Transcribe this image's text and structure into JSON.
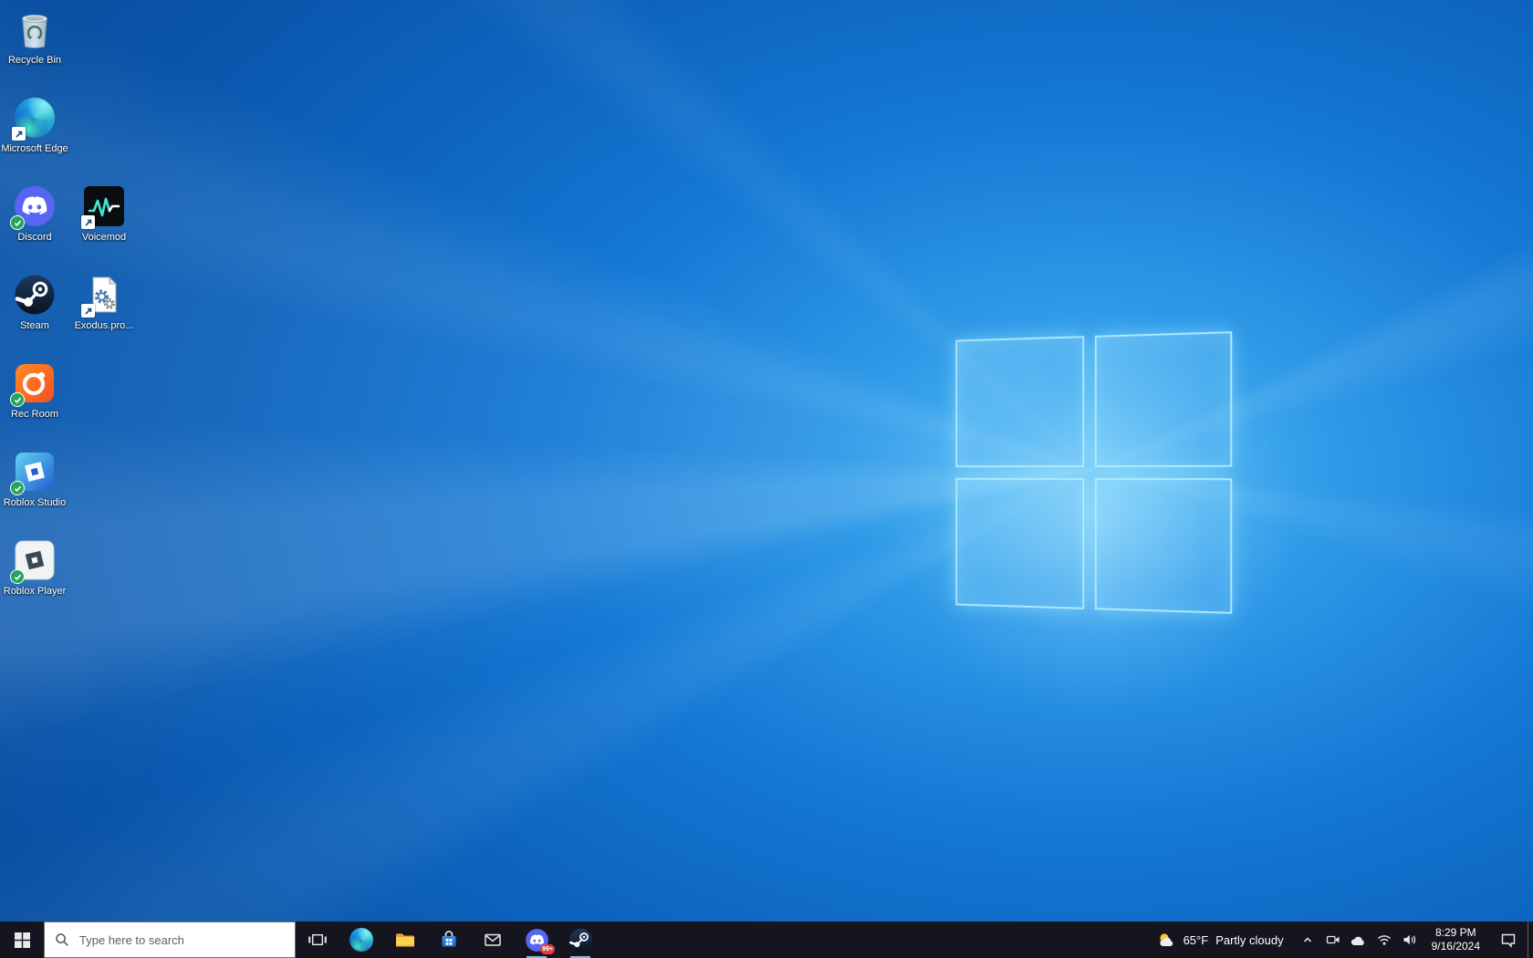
{
  "desktop": {
    "icons": [
      {
        "name": "recycle-bin",
        "label": "Recycle Bin",
        "overlay": "none"
      },
      {
        "name": "microsoft-edge",
        "label": "Microsoft Edge",
        "overlay": "shortcut-arrow"
      },
      {
        "name": "discord",
        "label": "Discord",
        "overlay": "sync-check"
      },
      {
        "name": "voicemod",
        "label": "Voicemod",
        "overlay": "shortcut-arrow"
      },
      {
        "name": "steam",
        "label": "Steam",
        "overlay": "none"
      },
      {
        "name": "exodus",
        "label": "Exodus.pro...",
        "overlay": "shortcut-arrow"
      },
      {
        "name": "rec-room",
        "label": "Rec Room",
        "overlay": "sync-check"
      },
      {
        "name": "roblox-studio",
        "label": "Roblox Studio",
        "overlay": "sync-check"
      },
      {
        "name": "roblox-player",
        "label": "Roblox Player",
        "overlay": "sync-check"
      }
    ]
  },
  "taskbar": {
    "search": {
      "placeholder": "Type here to search"
    },
    "app_icons": [
      "start",
      "task-view",
      "edge",
      "file-explorer",
      "microsoft-store",
      "mail",
      "discord",
      "steam"
    ],
    "discord_badge": "99+",
    "running_apps": [
      "discord",
      "steam"
    ]
  },
  "tray": {
    "weather": {
      "temperature": "65°F",
      "condition": "Partly cloudy"
    },
    "icons": [
      "hidden-icons-chevron",
      "meet-now-camera",
      "onedrive-cloud",
      "network-wifi",
      "volume-speaker"
    ],
    "clock": {
      "time": "8:29 PM",
      "date": "9/16/2024"
    }
  },
  "colors": {
    "taskbar": "#15151f",
    "wallpaper_base": "#0b5cb5",
    "wallpaper_highlight": "#57bff4",
    "discord_blurple": "#5865F2",
    "badge_red": "#e23d3d",
    "check_green": "#23a55a",
    "folder_yellow": "#ffd24a"
  }
}
